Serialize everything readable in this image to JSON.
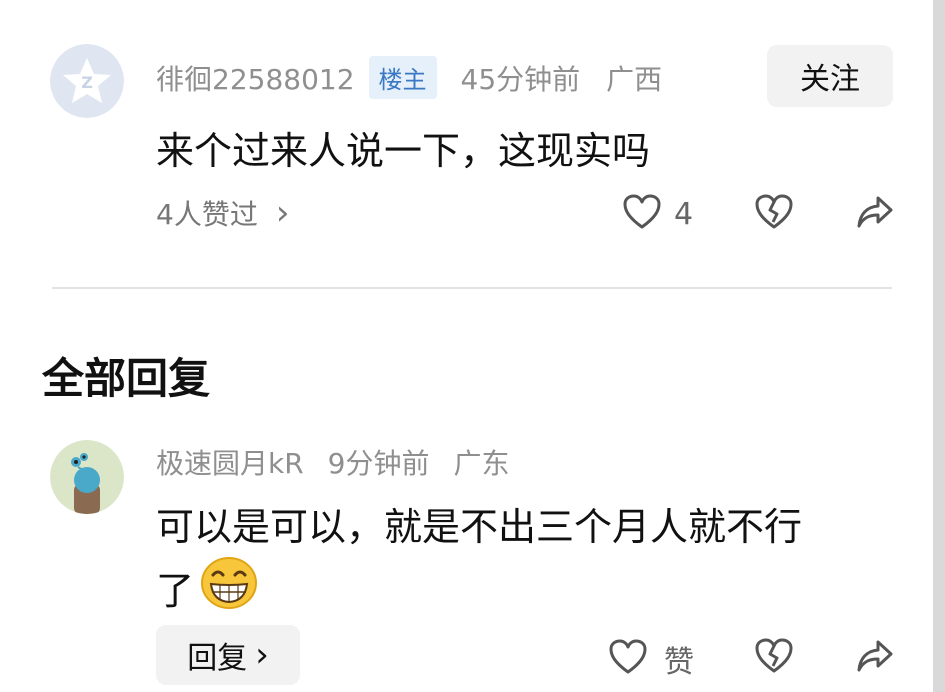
{
  "post": {
    "username": "徘徊22588012",
    "badge": "楼主",
    "time": "45分钟前",
    "location": "广西",
    "follow_label": "关注",
    "content": "来个过来人说一下，这现实吗",
    "likers": "4人赞过",
    "likers_chevron": "›",
    "like_count": "4"
  },
  "replies_section": {
    "title": "全部回复"
  },
  "reply": {
    "username": "极速圆月kR",
    "time": "9分钟前",
    "location": "广东",
    "content_line1": "可以是可以，就是不出三个月人就不行",
    "content_line2": "了",
    "reply_label": "回复",
    "reply_chevron": "›",
    "like_label": "赞"
  },
  "icons": {
    "like": "heart-icon",
    "dislike": "broken-heart-icon",
    "share": "share-arrow-icon",
    "emoji": "grinning-emoji-icon"
  }
}
